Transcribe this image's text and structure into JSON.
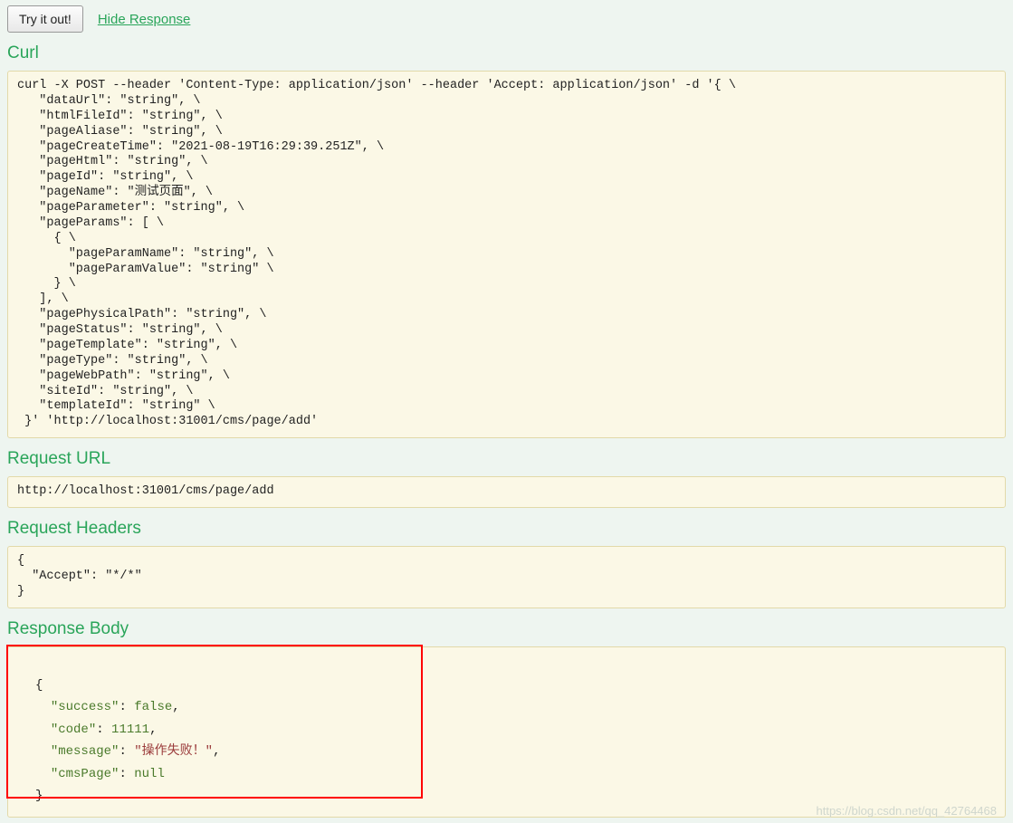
{
  "top": {
    "try_label": "Try it out!",
    "hide_label": "Hide Response"
  },
  "curl": {
    "heading": "Curl",
    "body": "curl -X POST --header 'Content-Type: application/json' --header 'Accept: application/json' -d '{ \\\n   \"dataUrl\": \"string\", \\\n   \"htmlFileId\": \"string\", \\\n   \"pageAliase\": \"string\", \\\n   \"pageCreateTime\": \"2021-08-19T16:29:39.251Z\", \\\n   \"pageHtml\": \"string\", \\\n   \"pageId\": \"string\", \\\n   \"pageName\": \"测试页面\", \\\n   \"pageParameter\": \"string\", \\\n   \"pageParams\": [ \\\n     { \\\n       \"pageParamName\": \"string\", \\\n       \"pageParamValue\": \"string\" \\\n     } \\\n   ], \\\n   \"pagePhysicalPath\": \"string\", \\\n   \"pageStatus\": \"string\", \\\n   \"pageTemplate\": \"string\", \\\n   \"pageType\": \"string\", \\\n   \"pageWebPath\": \"string\", \\\n   \"siteId\": \"string\", \\\n   \"templateId\": \"string\" \\\n }' 'http://localhost:31001/cms/page/add'"
  },
  "request_url": {
    "heading": "Request URL",
    "body": "http://localhost:31001/cms/page/add"
  },
  "request_headers": {
    "heading": "Request Headers",
    "body": "{\n  \"Accept\": \"*/*\"\n}"
  },
  "response_body": {
    "heading": "Response Body",
    "labels": {
      "success": "\"success\"",
      "code": "\"code\"",
      "message": "\"message\"",
      "cmsPage": "\"cmsPage\""
    },
    "values": {
      "success": "false",
      "code": "11111",
      "message": "\"操作失败！\"",
      "cmsPage": "null"
    }
  },
  "watermark": "https://blog.csdn.net/qq_42764468"
}
